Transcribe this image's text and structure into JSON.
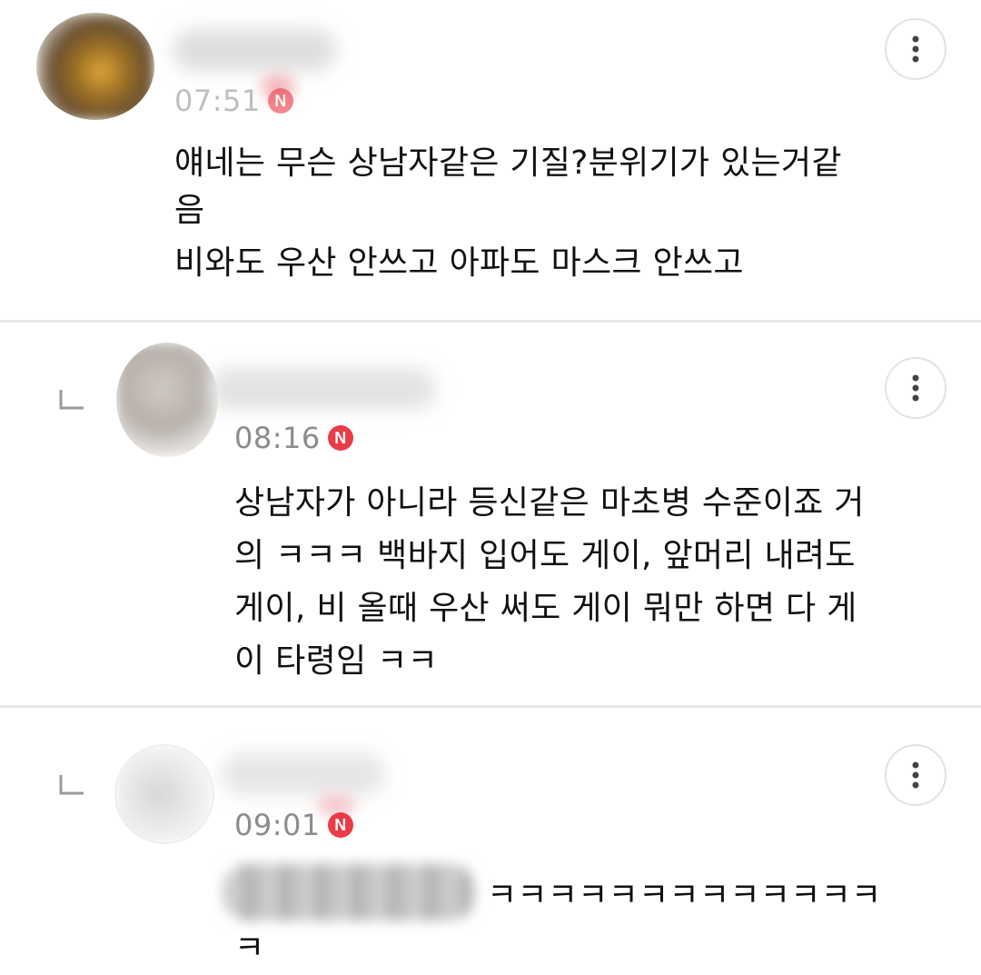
{
  "comments": [
    {
      "time": "07:51",
      "badge": "N",
      "is_reply": false,
      "lines": [
        "얘네는 무슨 상남자같은 기질?분위기가 있는거같",
        "음",
        "비와도 우산 안쓰고 아파도 마스크 안쓰고"
      ]
    },
    {
      "time": "08:16",
      "badge": "N",
      "is_reply": true,
      "lines": [
        "상남자가 아니라 등신같은 마초병 수준이죠 거",
        "의 ㅋㅋㅋ 백바지 입어도 게이, 앞머리 내려도",
        "게이, 비 올때 우산 써도 게이 뭐만 하면 다 게",
        "이 타령임 ㅋㅋ"
      ]
    },
    {
      "time": "09:01",
      "badge": "N",
      "is_reply": true,
      "lines": [
        "ㅋㅋㅋㅋㅋㅋㅋㅋㅋㅋㅋㅋㅋ",
        "ㅋ"
      ]
    }
  ],
  "icons": {
    "more": "more-vertical-icon",
    "reply": "reply-arrow-icon",
    "new_badge": "new-badge-icon"
  },
  "colors": {
    "badge": "#ea3b48",
    "time": "#8c8c8c",
    "divider": "#e8e8e8",
    "text": "#111111"
  }
}
